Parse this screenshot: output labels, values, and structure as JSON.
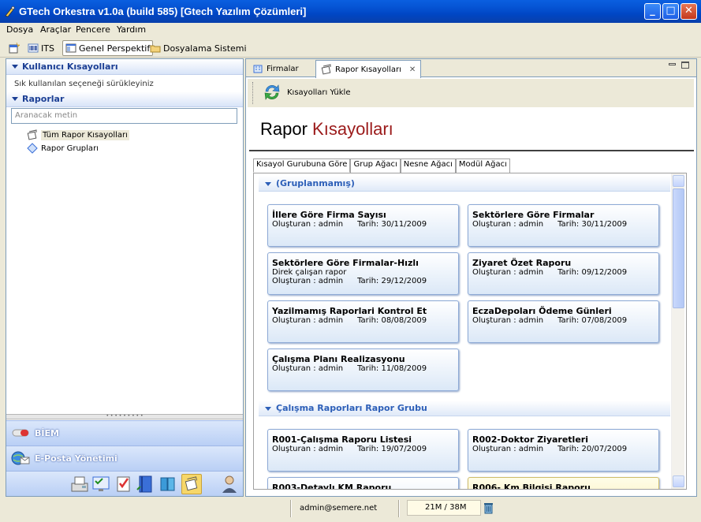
{
  "window": {
    "title": "GTech Orkestra v1.0a (build 585) [Gtech Yazılım Çözümleri]",
    "minimize": "_",
    "maximize": "□",
    "close": "✕"
  },
  "menu": [
    "Dosya",
    "Araçlar",
    "Pencere",
    "Yardım"
  ],
  "toolbar": {
    "its_label": "ITS",
    "perspective_label": "Genel Perspektif",
    "filesystem_label": "Dosyalama Sistemi"
  },
  "left": {
    "shortcuts_header": "Kullanıcı Kısayolları",
    "shortcuts_hint": "Sık kullanılan seçeneği sürükleyiniz",
    "reports_header": "Raporlar",
    "search_placeholder": "Aranacak metin",
    "tree": [
      "Tüm Rapor Kısayolları",
      "Rapor Grupları"
    ],
    "nav": [
      "BİEM",
      "E-Posta Yönetimi"
    ]
  },
  "right": {
    "tabs": [
      "Firmalar",
      "Rapor Kısayolları"
    ],
    "load_button": "Kısayolları Yükle",
    "title_black": "Rapor ",
    "title_red": "Kısayolları",
    "subtabs": [
      "Kısayol Gurubuna Göre",
      "Grup Ağacı",
      "Nesne Ağacı",
      "Modül Ağacı"
    ],
    "groups": [
      {
        "name": "(Gruplanmamış)",
        "cards": [
          {
            "title": "İllere Göre Firma Sayısı",
            "creator": "Oluşturan : admin",
            "date": "Tarih: 30/11/2009"
          },
          {
            "title": "Sektörlere Göre Firmalar",
            "creator": "Oluşturan : admin",
            "date": "Tarih: 30/11/2009"
          },
          {
            "title": "Sektörlere Göre Firmalar-Hızlı",
            "desc": "Direk çalışan rapor",
            "creator": "Oluşturan : admin",
            "date": "Tarih: 29/12/2009"
          },
          {
            "title": "Ziyaret Özet Raporu",
            "creator": "Oluşturan : admin",
            "date": "Tarih: 09/12/2009"
          },
          {
            "title": "Yazilmamış Raporlari Kontrol Et",
            "creator": "Oluşturan : admin",
            "date": "Tarih: 08/08/2009"
          },
          {
            "title": "EczaDepoları Ödeme Günleri",
            "creator": "Oluşturan : admin",
            "date": "Tarih: 07/08/2009"
          },
          {
            "title": "Çalışma Planı Realizasyonu",
            "creator": "Oluşturan : admin",
            "date": "Tarih: 11/08/2009"
          }
        ]
      },
      {
        "name": "Çalışma Raporları Rapor Grubu",
        "cards": [
          {
            "title": "R001-Çalışma Raporu Listesi",
            "creator": "Oluşturan : admin",
            "date": "Tarih: 19/07/2009"
          },
          {
            "title": "R002-Doktor Ziyaretleri",
            "creator": "Oluşturan : admin",
            "date": "Tarih: 20/07/2009"
          },
          {
            "title": "R003-Detaylı KM Raporu"
          },
          {
            "title": "R006- Km Bilgisi Raporu"
          }
        ]
      }
    ]
  },
  "status": {
    "user": "admin@semere.net",
    "mem_used": "21M",
    "mem_sep": " / ",
    "mem_total": "38M"
  },
  "colors": {
    "title_red": "#9b1a1a",
    "accent_blue": "#1c3f94",
    "titlebar": "#0450d0"
  }
}
